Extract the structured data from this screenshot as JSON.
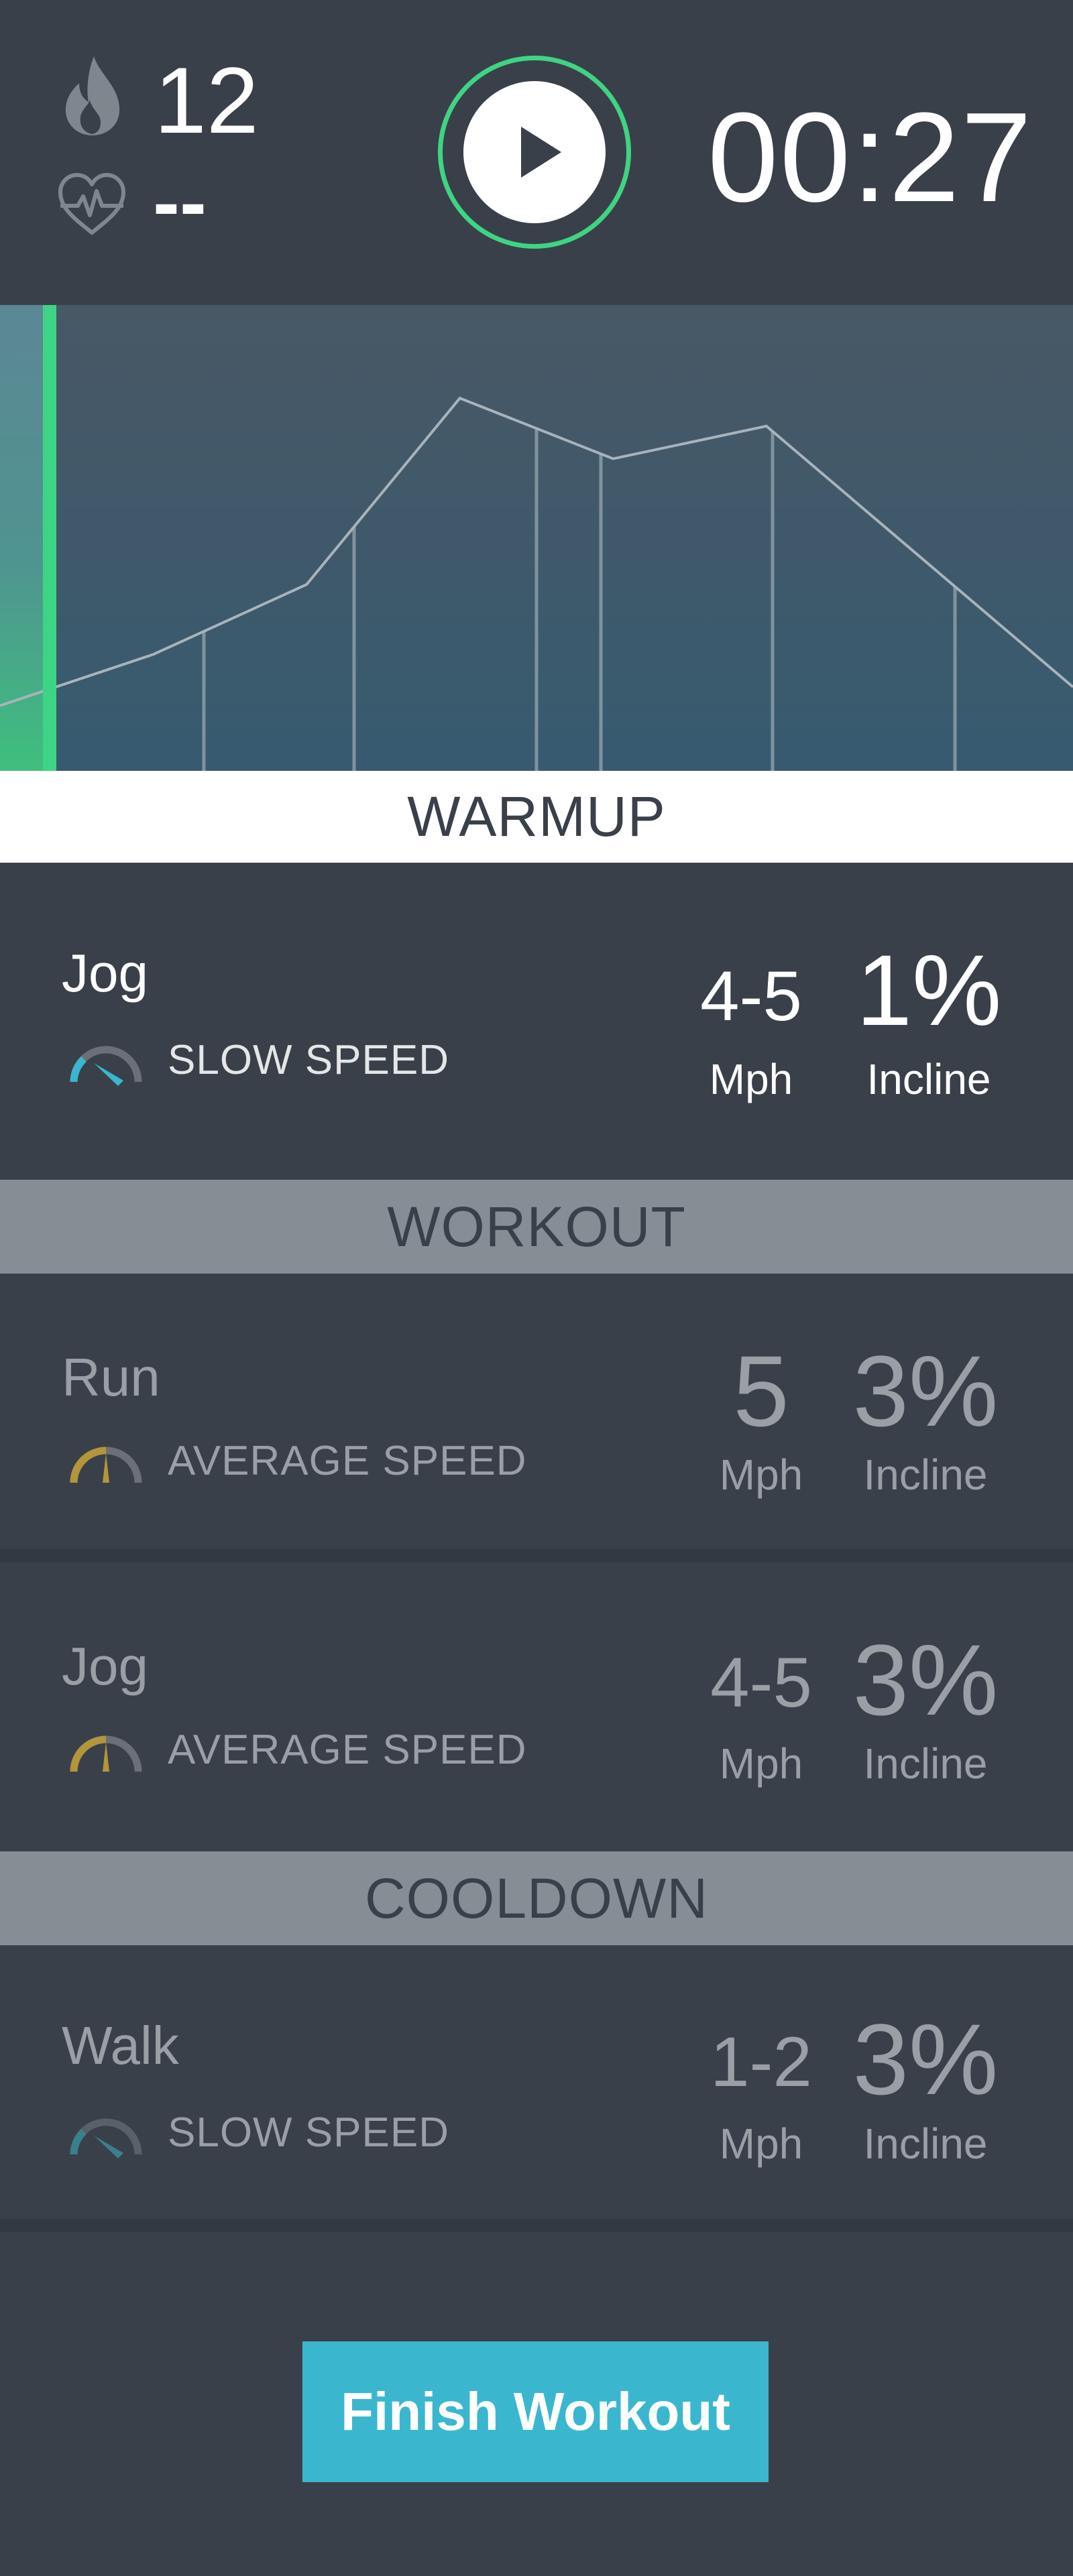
{
  "header": {
    "calories": "12",
    "heart_rate": "--",
    "timer": "00:27",
    "flame_icon": "flame-icon",
    "heart_icon": "heart-pulse-icon",
    "play_icon": "play-icon",
    "accent_color": "#3ed485"
  },
  "chart": {
    "progress_fraction": 0.04,
    "profile_points": [
      0.14,
      0.25,
      0.4,
      0.8,
      0.67,
      0.74,
      0.46,
      0.18
    ],
    "segment_markers": [
      0.19,
      0.33,
      0.5,
      0.56,
      0.72,
      0.89
    ]
  },
  "sections": {
    "warmup": "WARMUP",
    "workout": "WORKOUT",
    "cooldown": "COOLDOWN"
  },
  "rows": [
    {
      "name": "Jog",
      "speed_label": "SLOW SPEED",
      "speed": "4-5",
      "speed_unit": "Mph",
      "incline": "1%",
      "incline_unit": "Incline",
      "gauge_color": "#3ab7cf"
    },
    {
      "name": "Run",
      "speed_label": "AVERAGE SPEED",
      "speed": "5",
      "speed_unit": "Mph",
      "incline": "3%",
      "incline_unit": "Incline",
      "gauge_color": "#b3953a"
    },
    {
      "name": "Jog",
      "speed_label": "AVERAGE SPEED",
      "speed": "4-5",
      "speed_unit": "Mph",
      "incline": "3%",
      "incline_unit": "Incline",
      "gauge_color": "#b3953a"
    },
    {
      "name": "Walk",
      "speed_label": "SLOW SPEED",
      "speed": "1-2",
      "speed_unit": "Mph",
      "incline": "3%",
      "incline_unit": "Incline",
      "gauge_color": "#3b7f8f"
    }
  ],
  "finish_button": "Finish Workout",
  "colors": {
    "background": "#3a4049",
    "button": "#3ab7cf",
    "section_gray": "#878d95"
  }
}
